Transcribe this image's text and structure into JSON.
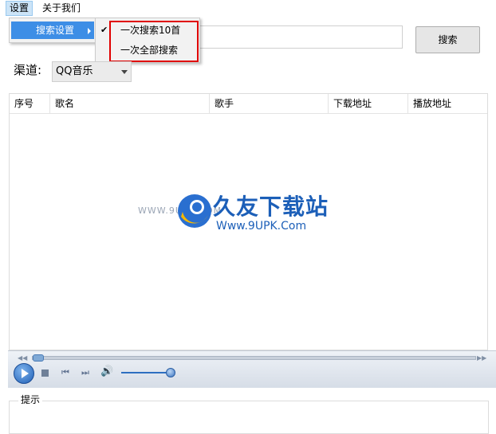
{
  "menubar": {
    "settings": "设置",
    "about": "关于我们"
  },
  "settings_menu": {
    "search_settings": "搜索设置"
  },
  "search_submenu": {
    "check_mark": "✔",
    "items": [
      "一次搜索10首",
      "一次全部搜索"
    ]
  },
  "search": {
    "button_label": "搜索",
    "input_value": ""
  },
  "channel": {
    "label": "渠道:",
    "selected": "QQ音乐"
  },
  "table": {
    "columns": [
      "序号",
      "歌名",
      "歌手",
      "下载地址",
      "播放地址"
    ]
  },
  "watermark": {
    "cn": "久友下载站",
    "en": "Www.9UPK.Com",
    "www": "WWW.9UPK.COM"
  },
  "player": {
    "seek_progress": 0.02,
    "volume_level": 0.9
  },
  "hint": {
    "label": "提示"
  },
  "colors": {
    "menu_highlight": "#3d8ee6",
    "annotation_red": "#e00000",
    "watermark_blue": "#1c5fb8"
  }
}
